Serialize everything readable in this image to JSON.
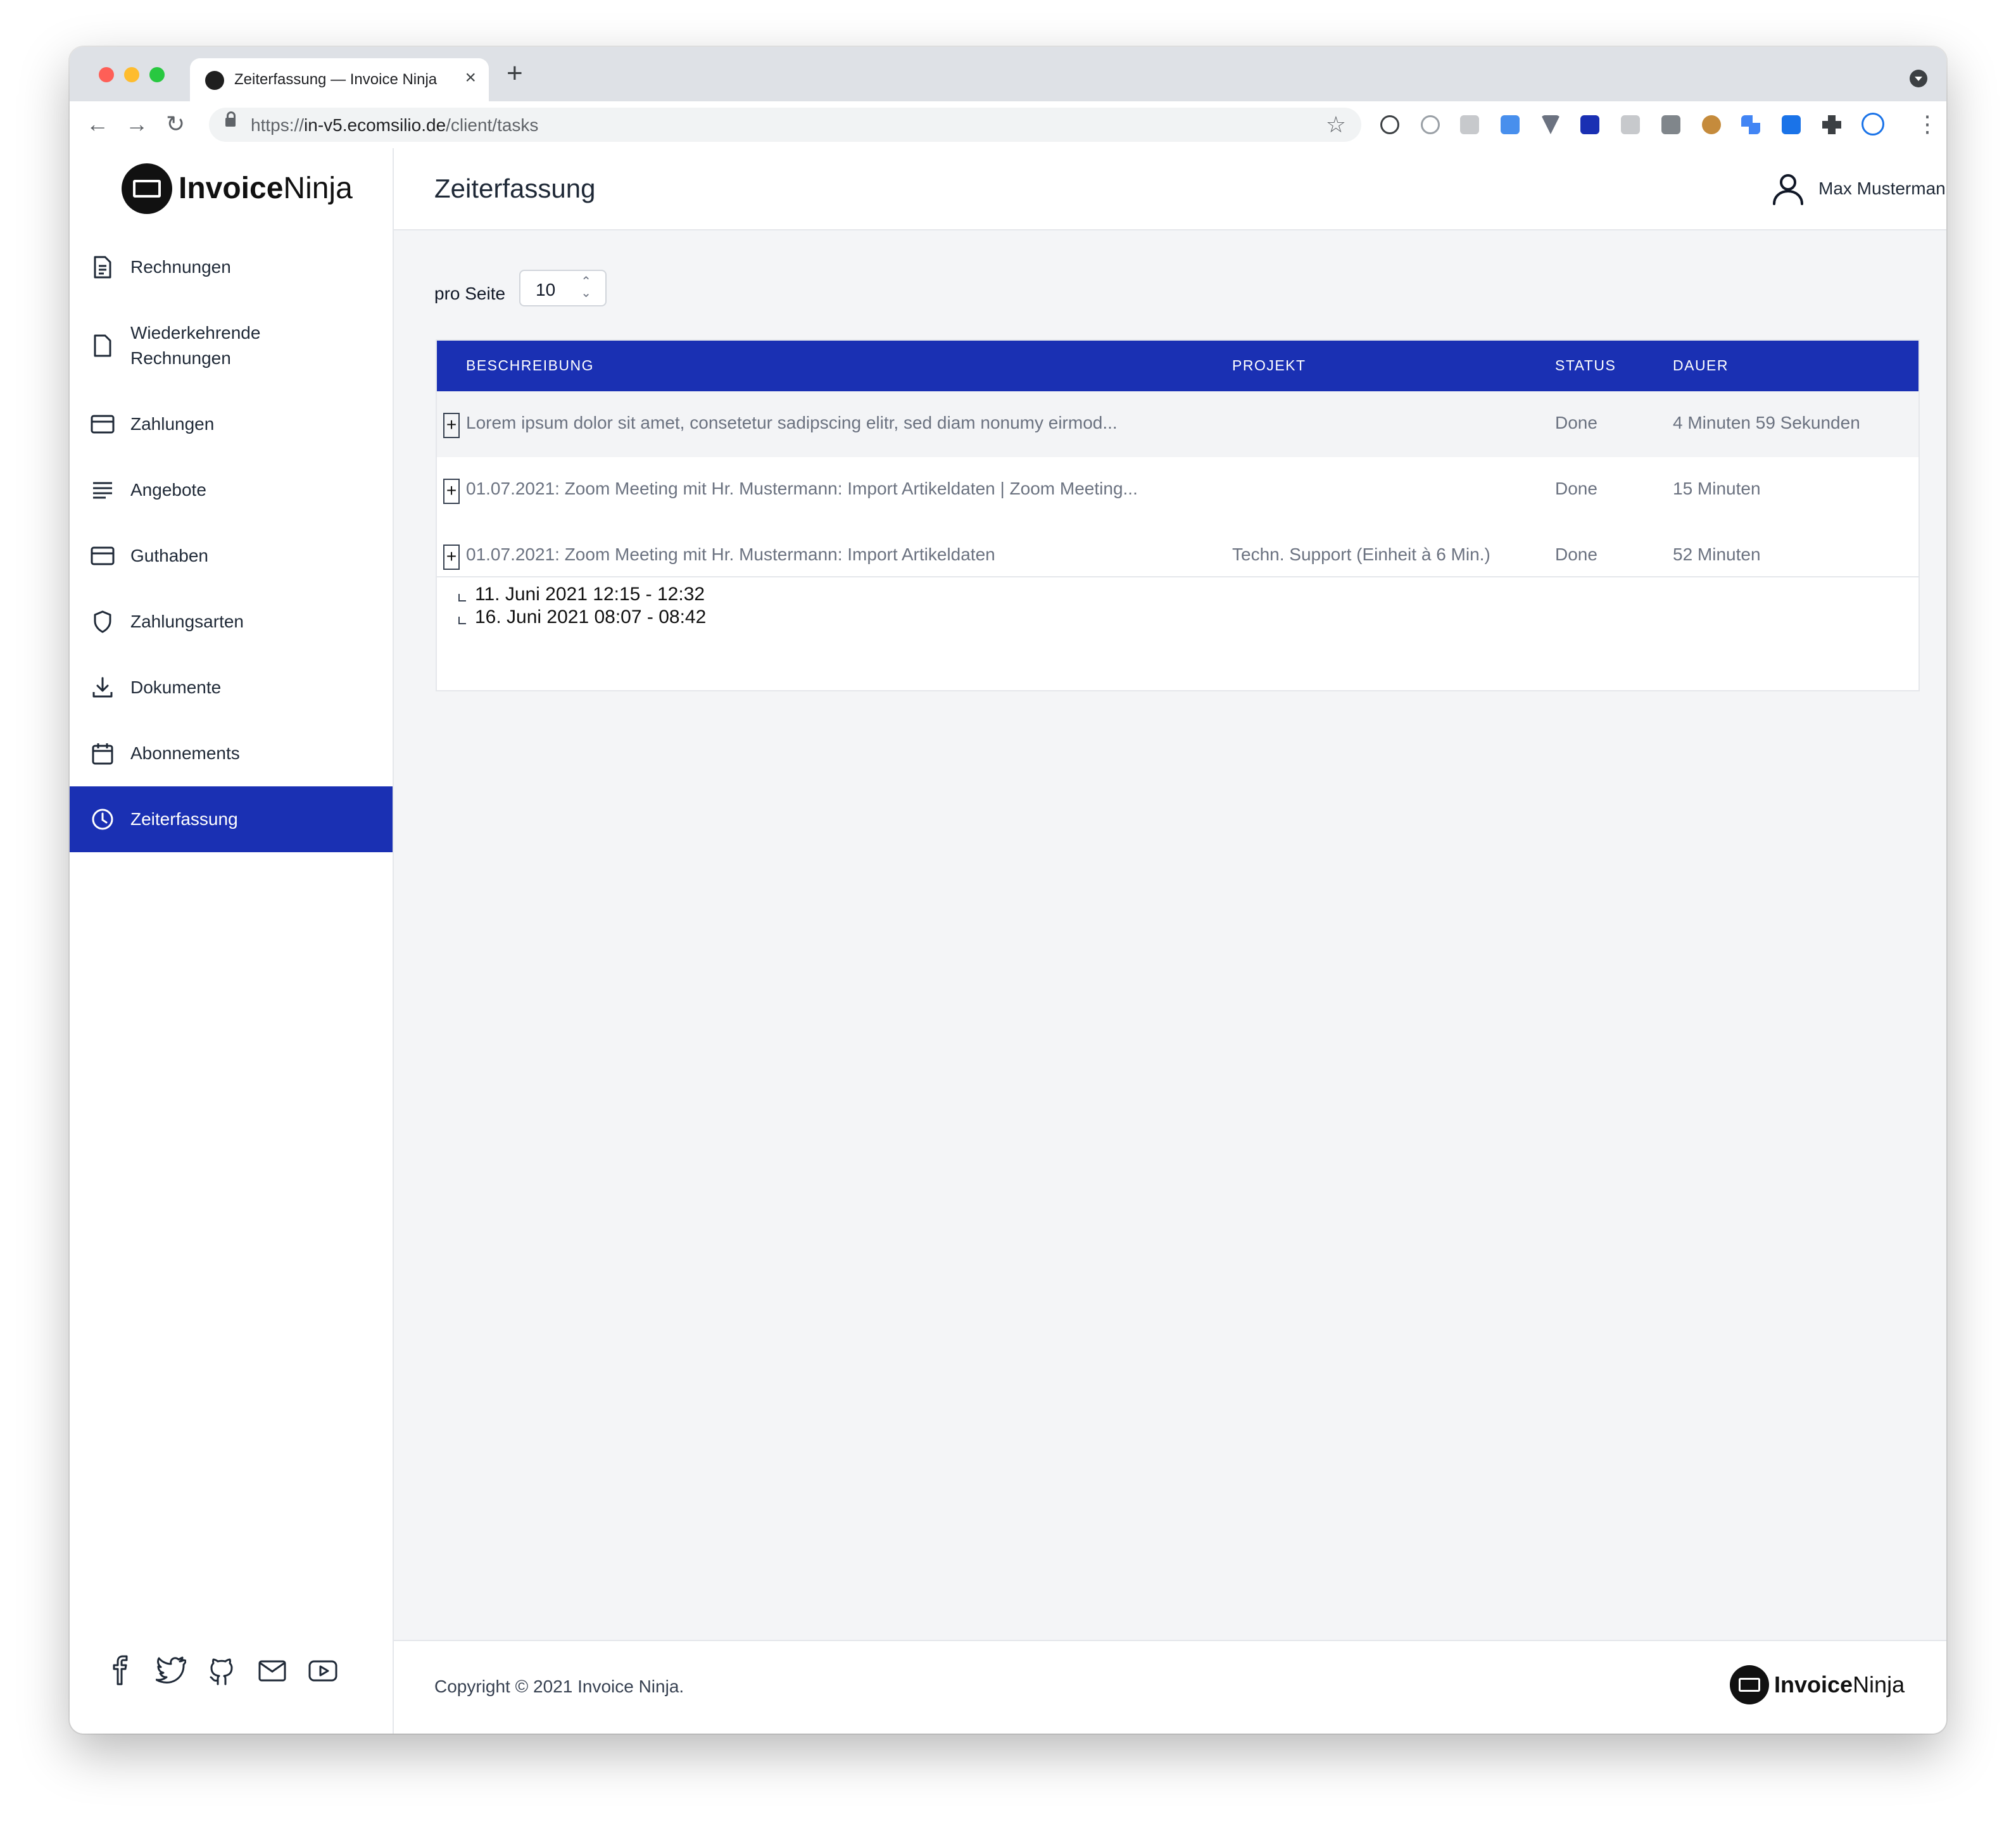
{
  "browser": {
    "tab_title": "Zeiterfassung — Invoice Ninja",
    "url_scheme": "https://",
    "url_host": "in-v5.ecomsilio.de",
    "url_path": "/client/tasks"
  },
  "brand": {
    "name_bold": "Invoice",
    "name_light": "Ninja"
  },
  "sidebar": {
    "items": [
      {
        "label": "Rechnungen",
        "icon": "document-icon"
      },
      {
        "label": "Wiederkehrende",
        "label2": "Rechnungen",
        "icon": "file-icon"
      },
      {
        "label": "Zahlungen",
        "icon": "credit-card-icon"
      },
      {
        "label": "Angebote",
        "icon": "align-left-icon"
      },
      {
        "label": "Guthaben",
        "icon": "credit-card-icon"
      },
      {
        "label": "Zahlungsarten",
        "icon": "shield-icon"
      },
      {
        "label": "Dokumente",
        "icon": "download-icon"
      },
      {
        "label": "Abonnements",
        "icon": "calendar-icon"
      },
      {
        "label": "Zeiterfassung",
        "icon": "clock-icon",
        "active": true
      }
    ],
    "social": [
      "facebook-icon",
      "twitter-icon",
      "github-icon",
      "mail-icon",
      "youtube-icon"
    ]
  },
  "header": {
    "title": "Zeiterfassung",
    "user_name": "Max Mustermann"
  },
  "per_page": {
    "label": "pro Seite",
    "value": "10"
  },
  "table": {
    "columns": [
      "BESCHREIBUNG",
      "PROJEKT",
      "STATUS",
      "DAUER"
    ],
    "rows": [
      {
        "description": "Lorem ipsum dolor sit amet, consetetur sadipscing elitr, sed diam nonumy eirmod...",
        "project": "",
        "status": "Done",
        "duration": "4 Minuten 59 Sekunden"
      },
      {
        "description": "01.07.2021: Zoom Meeting mit Hr. Mustermann: Import Artikeldaten | Zoom Meeting...",
        "project": "",
        "status": "Done",
        "duration": "15 Minuten"
      },
      {
        "description": "01.07.2021: Zoom Meeting mit Hr. Mustermann: Import Artikeldaten",
        "project": "Techn. Support (Einheit à 6 Min.)",
        "status": "Done",
        "duration": "52 Minuten"
      }
    ],
    "expand_label": "+",
    "time_log": [
      "11. Juni 2021 12:15 - 12:32",
      "16. Juni 2021 08:07 - 08:42"
    ]
  },
  "footer": {
    "copyright": "Copyright © 2021 Invoice Ninja."
  },
  "colors": {
    "primary": "#1a30b3",
    "background": "#f4f5f7"
  }
}
